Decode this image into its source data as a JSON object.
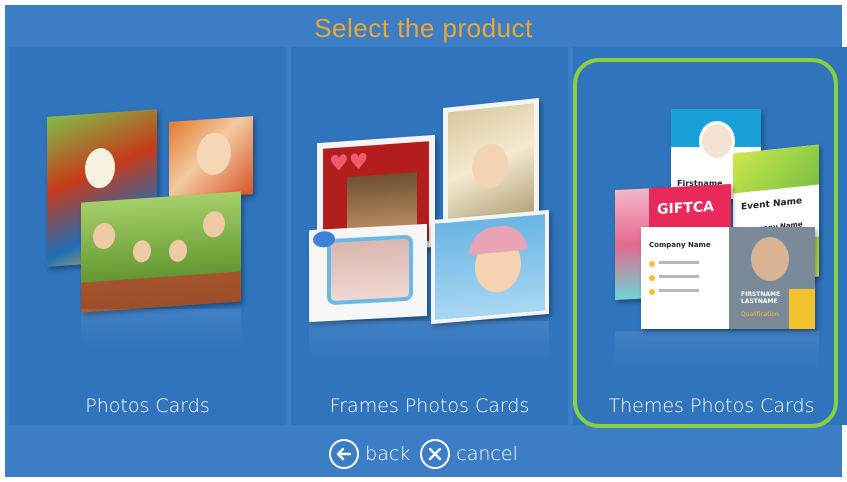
{
  "header": {
    "title": "Select the product"
  },
  "products": [
    {
      "label": "Photos Cards",
      "selected": false
    },
    {
      "label": "Frames Photos Cards",
      "selected": false
    },
    {
      "label": "Themes Photos Cards",
      "selected": true
    }
  ],
  "theme_cards": {
    "gift": "GIFTCA",
    "event_name": "Event Name",
    "company_name": "Company Name",
    "firstname": "Firstname",
    "business_company": "Company Name",
    "firstname_lastname": "FIRSTNAME LASTNAME",
    "qualification": "Qualification"
  },
  "footer": {
    "back_label": "back",
    "cancel_label": "cancel"
  },
  "colors": {
    "background": "#3c7ec5",
    "panel": "#2f74bd",
    "title": "#f0a72e",
    "selection": "#8ccf3c"
  }
}
